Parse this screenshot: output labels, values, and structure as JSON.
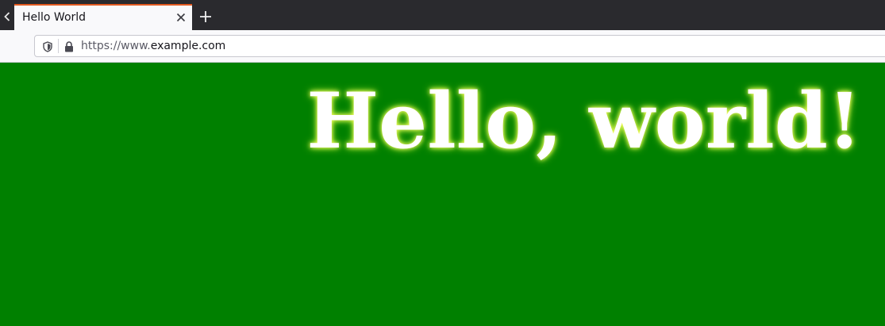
{
  "tab": {
    "title": "Hello World"
  },
  "address_bar": {
    "url_scheme": "https://www.",
    "url_host": "example.com"
  },
  "page": {
    "heading": "Hello, world!",
    "background_color": "#008000",
    "heading_color": "#ffffff",
    "glow_color": "#ffff66"
  },
  "icons": {
    "tab_overflow": "chevron-left-icon",
    "tab_close": "close-icon",
    "new_tab": "plus-icon",
    "tracking_protection": "shield-icon",
    "secure_connection": "lock-icon"
  },
  "colors": {
    "tab_accent": "#e25920",
    "tabstrip": "#2a2a2e",
    "toolbar": "#f9f9fb"
  }
}
